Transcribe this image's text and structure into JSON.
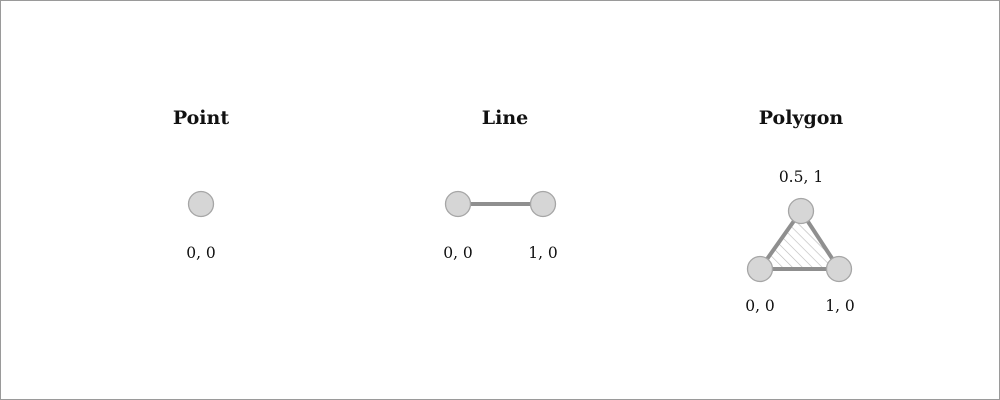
{
  "colors": {
    "vertex_fill": "#d6d6d6",
    "vertex_stroke": "#a6a6a6",
    "edge": "#8f8f8f",
    "hatch": "#b9b9b9",
    "text": "#111111",
    "border": "#9a9a9a"
  },
  "point": {
    "title": "Point",
    "coord_label": "0, 0"
  },
  "line": {
    "title": "Line",
    "start_label": "0, 0",
    "end_label": "1, 0"
  },
  "polygon": {
    "title": "Polygon",
    "top_label": "0.5, 1",
    "left_label": "0, 0",
    "right_label": "1, 0"
  }
}
